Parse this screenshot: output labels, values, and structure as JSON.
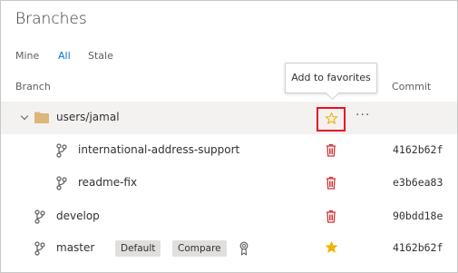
{
  "page": {
    "title": "Branches"
  },
  "tabs": [
    {
      "label": "Mine",
      "active": false
    },
    {
      "label": "All",
      "active": true
    },
    {
      "label": "Stale",
      "active": false
    }
  ],
  "columns": {
    "branch": "Branch",
    "commit": "Commit"
  },
  "tooltip": {
    "text": "Add to favorites"
  },
  "rows": [
    {
      "name": "users/jamal",
      "type": "folder",
      "expanded": true,
      "favorite": false,
      "commit": ""
    },
    {
      "name": "international-address-support",
      "type": "branch",
      "level": 2,
      "commit": "4162b62f",
      "deletable": true
    },
    {
      "name": "readme-fix",
      "type": "branch",
      "level": 2,
      "commit": "e3b6ea83",
      "deletable": true
    },
    {
      "name": "develop",
      "type": "branch",
      "level": 1,
      "commit": "90bdd18e",
      "deletable": true
    },
    {
      "name": "master",
      "type": "branch",
      "level": 1,
      "commit": "4162b62f",
      "favorite": true,
      "badges": {
        "default": "Default",
        "compare": "Compare"
      }
    }
  ],
  "colors": {
    "accent": "#0078d4",
    "delete": "#d13438",
    "star": "#f2b200",
    "highlight": "#e81123",
    "folder": "#dcb67a"
  }
}
